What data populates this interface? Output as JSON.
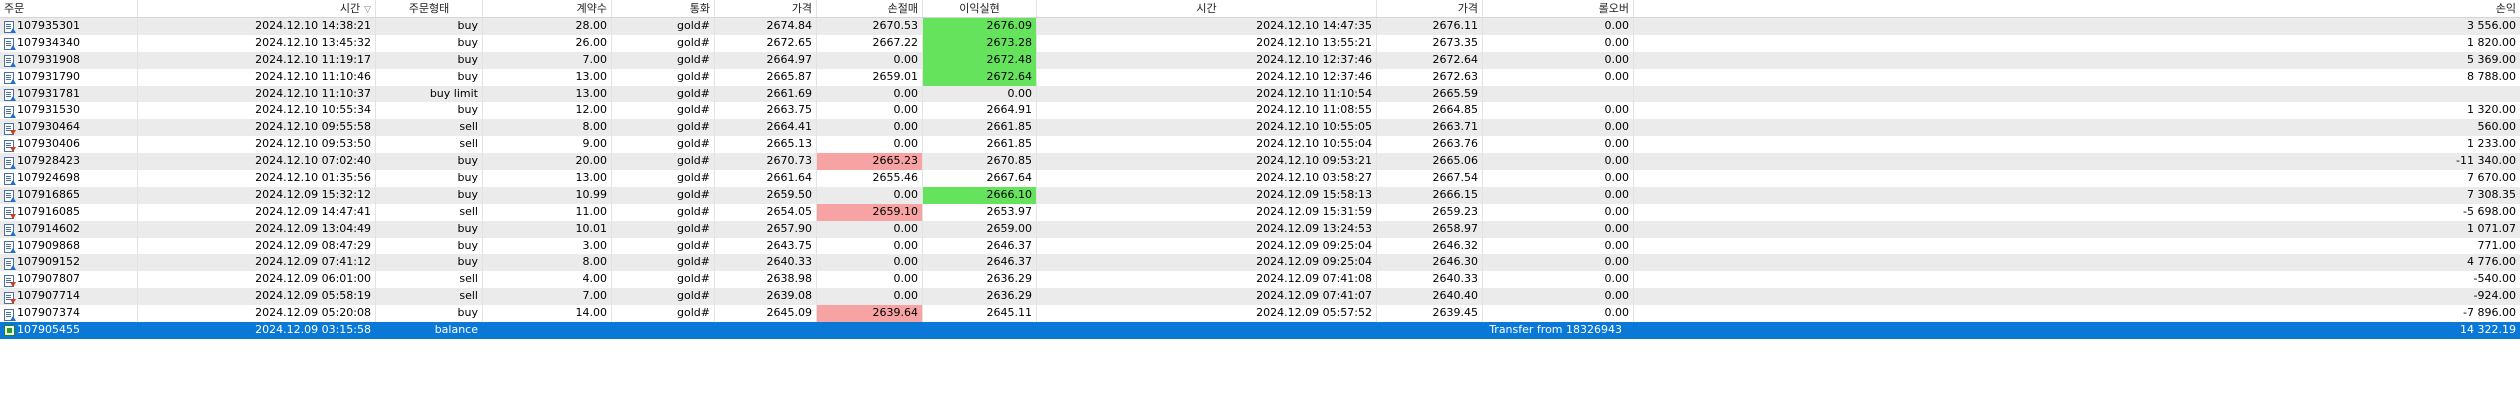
{
  "headers": [
    "주문",
    "시간",
    "주문형태",
    "계약수",
    "통화",
    "가격",
    "손절매",
    "이익실현",
    "시간",
    "가격",
    "롤오버",
    "손익"
  ],
  "sort_indicator": "▽",
  "colors": {
    "selected_row": "#0a78d7",
    "hit_tp": "#66e35d",
    "hit_sl": "#f7a3a3",
    "odd_row": "#ebebeb"
  },
  "rows": [
    {
      "order": "107935301",
      "time": "2024.12.10 14:38:21",
      "type": "buy",
      "volume": "28.00",
      "symbol": "gold#",
      "price": "2674.84",
      "sl": "2670.53",
      "tp": "2676.09",
      "close_time": "2024.12.10 14:47:35",
      "close_price": "2676.11",
      "swap": "0.00",
      "profit": "3 556.00",
      "icon": "buy-order-icon",
      "hl_tp": true
    },
    {
      "order": "107934340",
      "time": "2024.12.10 13:45:32",
      "type": "buy",
      "volume": "26.00",
      "symbol": "gold#",
      "price": "2672.65",
      "sl": "2667.22",
      "tp": "2673.28",
      "close_time": "2024.12.10 13:55:21",
      "close_price": "2673.35",
      "swap": "0.00",
      "profit": "1 820.00",
      "icon": "buy-order-icon",
      "hl_tp": true
    },
    {
      "order": "107931908",
      "time": "2024.12.10 11:19:17",
      "type": "buy",
      "volume": "7.00",
      "symbol": "gold#",
      "price": "2664.97",
      "sl": "0.00",
      "tp": "2672.48",
      "close_time": "2024.12.10 12:37:46",
      "close_price": "2672.64",
      "swap": "0.00",
      "profit": "5 369.00",
      "icon": "buy-order-icon",
      "hl_tp": true
    },
    {
      "order": "107931790",
      "time": "2024.12.10 11:10:46",
      "type": "buy",
      "volume": "13.00",
      "symbol": "gold#",
      "price": "2665.87",
      "sl": "2659.01",
      "tp": "2672.64",
      "close_time": "2024.12.10 12:37:46",
      "close_price": "2672.63",
      "swap": "0.00",
      "profit": "8 788.00",
      "icon": "buy-order-icon",
      "hl_tp": true
    },
    {
      "order": "107931781",
      "time": "2024.12.10 11:10:37",
      "type": "buy limit",
      "volume": "13.00",
      "symbol": "gold#",
      "price": "2661.69",
      "sl": "0.00",
      "tp": "0.00",
      "close_time": "2024.12.10 11:10:54",
      "close_price": "2665.59",
      "swap": "",
      "profit": "",
      "icon": "pending-order-icon"
    },
    {
      "order": "107931530",
      "time": "2024.12.10 10:55:34",
      "type": "buy",
      "volume": "12.00",
      "symbol": "gold#",
      "price": "2663.75",
      "sl": "0.00",
      "tp": "2664.91",
      "close_time": "2024.12.10 11:08:55",
      "close_price": "2664.85",
      "swap": "0.00",
      "profit": "1 320.00",
      "icon": "buy-order-icon"
    },
    {
      "order": "107930464",
      "time": "2024.12.10 09:55:58",
      "type": "sell",
      "volume": "8.00",
      "symbol": "gold#",
      "price": "2664.41",
      "sl": "0.00",
      "tp": "2661.85",
      "close_time": "2024.12.10 10:55:05",
      "close_price": "2663.71",
      "swap": "0.00",
      "profit": "560.00",
      "icon": "sell-order-icon"
    },
    {
      "order": "107930406",
      "time": "2024.12.10 09:53:50",
      "type": "sell",
      "volume": "9.00",
      "symbol": "gold#",
      "price": "2665.13",
      "sl": "0.00",
      "tp": "2661.85",
      "close_time": "2024.12.10 10:55:04",
      "close_price": "2663.76",
      "swap": "0.00",
      "profit": "1 233.00",
      "icon": "sell-order-icon"
    },
    {
      "order": "107928423",
      "time": "2024.12.10 07:02:40",
      "type": "buy",
      "volume": "20.00",
      "symbol": "gold#",
      "price": "2670.73",
      "sl": "2665.23",
      "tp": "2670.85",
      "close_time": "2024.12.10 09:53:21",
      "close_price": "2665.06",
      "swap": "0.00",
      "profit": "-11 340.00",
      "icon": "buy-order-icon",
      "hl_sl": true
    },
    {
      "order": "107924698",
      "time": "2024.12.10 01:35:56",
      "type": "buy",
      "volume": "13.00",
      "symbol": "gold#",
      "price": "2661.64",
      "sl": "2655.46",
      "tp": "2667.64",
      "close_time": "2024.12.10 03:58:27",
      "close_price": "2667.54",
      "swap": "0.00",
      "profit": "7 670.00",
      "icon": "buy-order-icon"
    },
    {
      "order": "107916865",
      "time": "2024.12.09 15:32:12",
      "type": "buy",
      "volume": "10.99",
      "symbol": "gold#",
      "price": "2659.50",
      "sl": "0.00",
      "tp": "2666.10",
      "close_time": "2024.12.09 15:58:13",
      "close_price": "2666.15",
      "swap": "0.00",
      "profit": "7 308.35",
      "icon": "buy-order-icon",
      "hl_tp": true
    },
    {
      "order": "107916085",
      "time": "2024.12.09 14:47:41",
      "type": "sell",
      "volume": "11.00",
      "symbol": "gold#",
      "price": "2654.05",
      "sl": "2659.10",
      "tp": "2653.97",
      "close_time": "2024.12.09 15:31:59",
      "close_price": "2659.23",
      "swap": "0.00",
      "profit": "-5 698.00",
      "icon": "sell-order-icon",
      "hl_sl": true
    },
    {
      "order": "107914602",
      "time": "2024.12.09 13:04:49",
      "type": "buy",
      "volume": "10.01",
      "symbol": "gold#",
      "price": "2657.90",
      "sl": "0.00",
      "tp": "2659.00",
      "close_time": "2024.12.09 13:24:53",
      "close_price": "2658.97",
      "swap": "0.00",
      "profit": "1 071.07",
      "icon": "buy-order-icon"
    },
    {
      "order": "107909868",
      "time": "2024.12.09 08:47:29",
      "type": "buy",
      "volume": "3.00",
      "symbol": "gold#",
      "price": "2643.75",
      "sl": "0.00",
      "tp": "2646.37",
      "close_time": "2024.12.09 09:25:04",
      "close_price": "2646.32",
      "swap": "0.00",
      "profit": "771.00",
      "icon": "buy-order-icon"
    },
    {
      "order": "107909152",
      "time": "2024.12.09 07:41:12",
      "type": "buy",
      "volume": "8.00",
      "symbol": "gold#",
      "price": "2640.33",
      "sl": "0.00",
      "tp": "2646.37",
      "close_time": "2024.12.09 09:25:04",
      "close_price": "2646.30",
      "swap": "0.00",
      "profit": "4 776.00",
      "icon": "buy-order-icon"
    },
    {
      "order": "107907807",
      "time": "2024.12.09 06:01:00",
      "type": "sell",
      "volume": "4.00",
      "symbol": "gold#",
      "price": "2638.98",
      "sl": "0.00",
      "tp": "2636.29",
      "close_time": "2024.12.09 07:41:08",
      "close_price": "2640.33",
      "swap": "0.00",
      "profit": "-540.00",
      "icon": "sell-order-icon"
    },
    {
      "order": "107907714",
      "time": "2024.12.09 05:58:19",
      "type": "sell",
      "volume": "7.00",
      "symbol": "gold#",
      "price": "2639.08",
      "sl": "0.00",
      "tp": "2636.29",
      "close_time": "2024.12.09 07:41:07",
      "close_price": "2640.40",
      "swap": "0.00",
      "profit": "-924.00",
      "icon": "sell-order-icon"
    },
    {
      "order": "107907374",
      "time": "2024.12.09 05:20:08",
      "type": "buy",
      "volume": "14.00",
      "symbol": "gold#",
      "price": "2645.09",
      "sl": "2639.64",
      "tp": "2645.11",
      "close_time": "2024.12.09 05:57:52",
      "close_price": "2639.45",
      "swap": "0.00",
      "profit": "-7 896.00",
      "icon": "buy-order-icon",
      "hl_sl": true
    }
  ],
  "balance_row": {
    "order": "107905455",
    "time": "2024.12.09 03:15:58",
    "type": "balance",
    "comment": "Transfer from 18326943",
    "profit": "14 322.19",
    "icon": "balance-icon"
  }
}
